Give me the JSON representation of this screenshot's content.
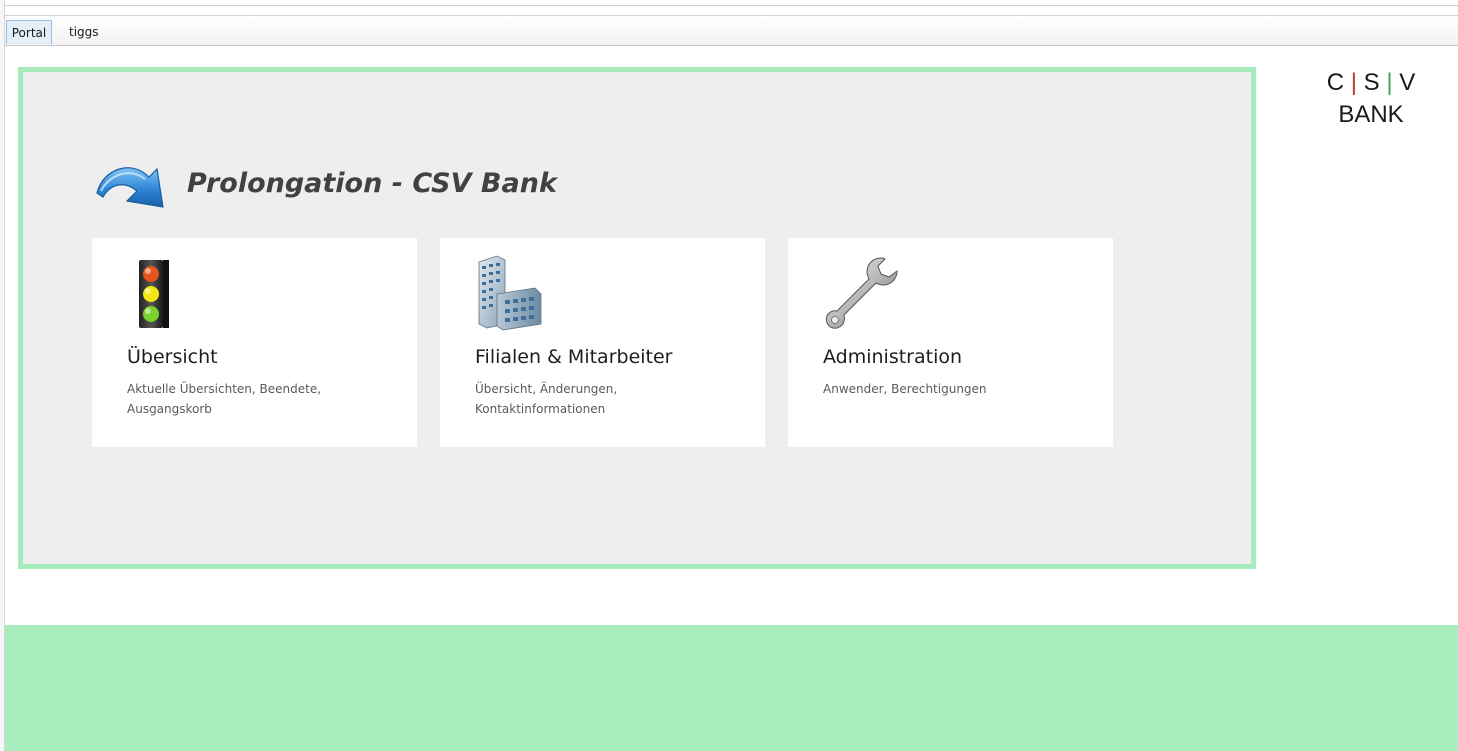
{
  "tabs": [
    {
      "label": "Portal",
      "active": true
    },
    {
      "label": "tiggs",
      "active": false
    }
  ],
  "header": {
    "title": "Prolongation - CSV Bank",
    "icon": "curved-arrow-icon"
  },
  "tiles": [
    {
      "title": "Übersicht",
      "description": "Aktuelle Übersichten, Beendete, Ausgangskorb",
      "icon": "traffic-light-icon"
    },
    {
      "title": "Filialen & Mitarbeiter",
      "description": "Übersicht, Änderungen, Kontaktinformationen",
      "icon": "office-building-icon"
    },
    {
      "title": "Administration",
      "description": "Anwender, Berechtigungen",
      "icon": "wrench-icon"
    }
  ],
  "logo": {
    "c": "C",
    "s": "S",
    "v": "V",
    "sep": "|",
    "bank": "BANK"
  },
  "colors": {
    "accent_green": "#a7ebbc",
    "panel_bg": "#eeeeee",
    "tab_active_bg": "#e4eef8"
  }
}
